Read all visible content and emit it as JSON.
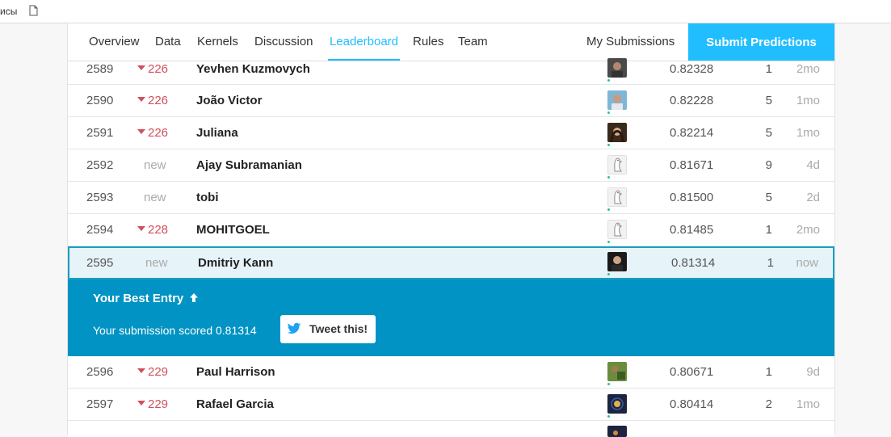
{
  "bookmarks": {
    "partial_text": "исы"
  },
  "tabs": [
    {
      "label": "Overview",
      "active": false
    },
    {
      "label": "Data",
      "active": false
    },
    {
      "label": "Kernels",
      "active": false
    },
    {
      "label": "Discussion",
      "active": false
    },
    {
      "label": "Leaderboard",
      "active": true
    },
    {
      "label": "Rules",
      "active": false
    },
    {
      "label": "Team",
      "active": false
    }
  ],
  "my_submissions_label": "My Submissions",
  "submit_label": "Submit Predictions",
  "rows_before": [
    {
      "rank": "2589",
      "delta": "226",
      "change": "down",
      "team": "Yevhen Kuzmovych",
      "avatar": "photo-dark",
      "score": "0.82328",
      "entries": "1",
      "last": "2mo"
    },
    {
      "rank": "2590",
      "delta": "226",
      "change": "down",
      "team": "João Victor",
      "avatar": "photo-blue",
      "score": "0.82228",
      "entries": "5",
      "last": "1mo"
    },
    {
      "rank": "2591",
      "delta": "226",
      "change": "down",
      "team": "Juliana",
      "avatar": "photo-woman",
      "score": "0.82214",
      "entries": "5",
      "last": "1mo"
    },
    {
      "rank": "2592",
      "delta": "new",
      "change": "new",
      "team": "Ajay Subramanian",
      "avatar": "goose",
      "score": "0.81671",
      "entries": "9",
      "last": "4d"
    },
    {
      "rank": "2593",
      "delta": "new",
      "change": "new",
      "team": "tobi",
      "avatar": "goose",
      "score": "0.81500",
      "entries": "5",
      "last": "2d"
    },
    {
      "rank": "2594",
      "delta": "228",
      "change": "down",
      "team": "MOHITGOEL",
      "avatar": "goose",
      "score": "0.81485",
      "entries": "1",
      "last": "2mo"
    }
  ],
  "highlight_row": {
    "rank": "2595",
    "delta": "new",
    "change": "new",
    "team": "Dmitriy Kann",
    "avatar": "photo-man",
    "score": "0.81314",
    "entries": "1",
    "last": "now"
  },
  "best_entry": {
    "title": "Your Best Entry",
    "scored_text": "Your submission scored 0.81314",
    "tweet_label": "Tweet this!"
  },
  "rows_after": [
    {
      "rank": "2596",
      "delta": "229",
      "change": "down",
      "team": "Paul Harrison",
      "avatar": "photo-green",
      "score": "0.80671",
      "entries": "1",
      "last": "9d"
    },
    {
      "rank": "2597",
      "delta": "229",
      "change": "down",
      "team": "Rafael Garcia",
      "avatar": "photo-night",
      "score": "0.80414",
      "entries": "2",
      "last": "1mo"
    }
  ],
  "colors": {
    "accent": "#20beff",
    "best_bg": "#0093c4",
    "down": "#d0505a",
    "highlight_bg": "#e6f3f8"
  }
}
